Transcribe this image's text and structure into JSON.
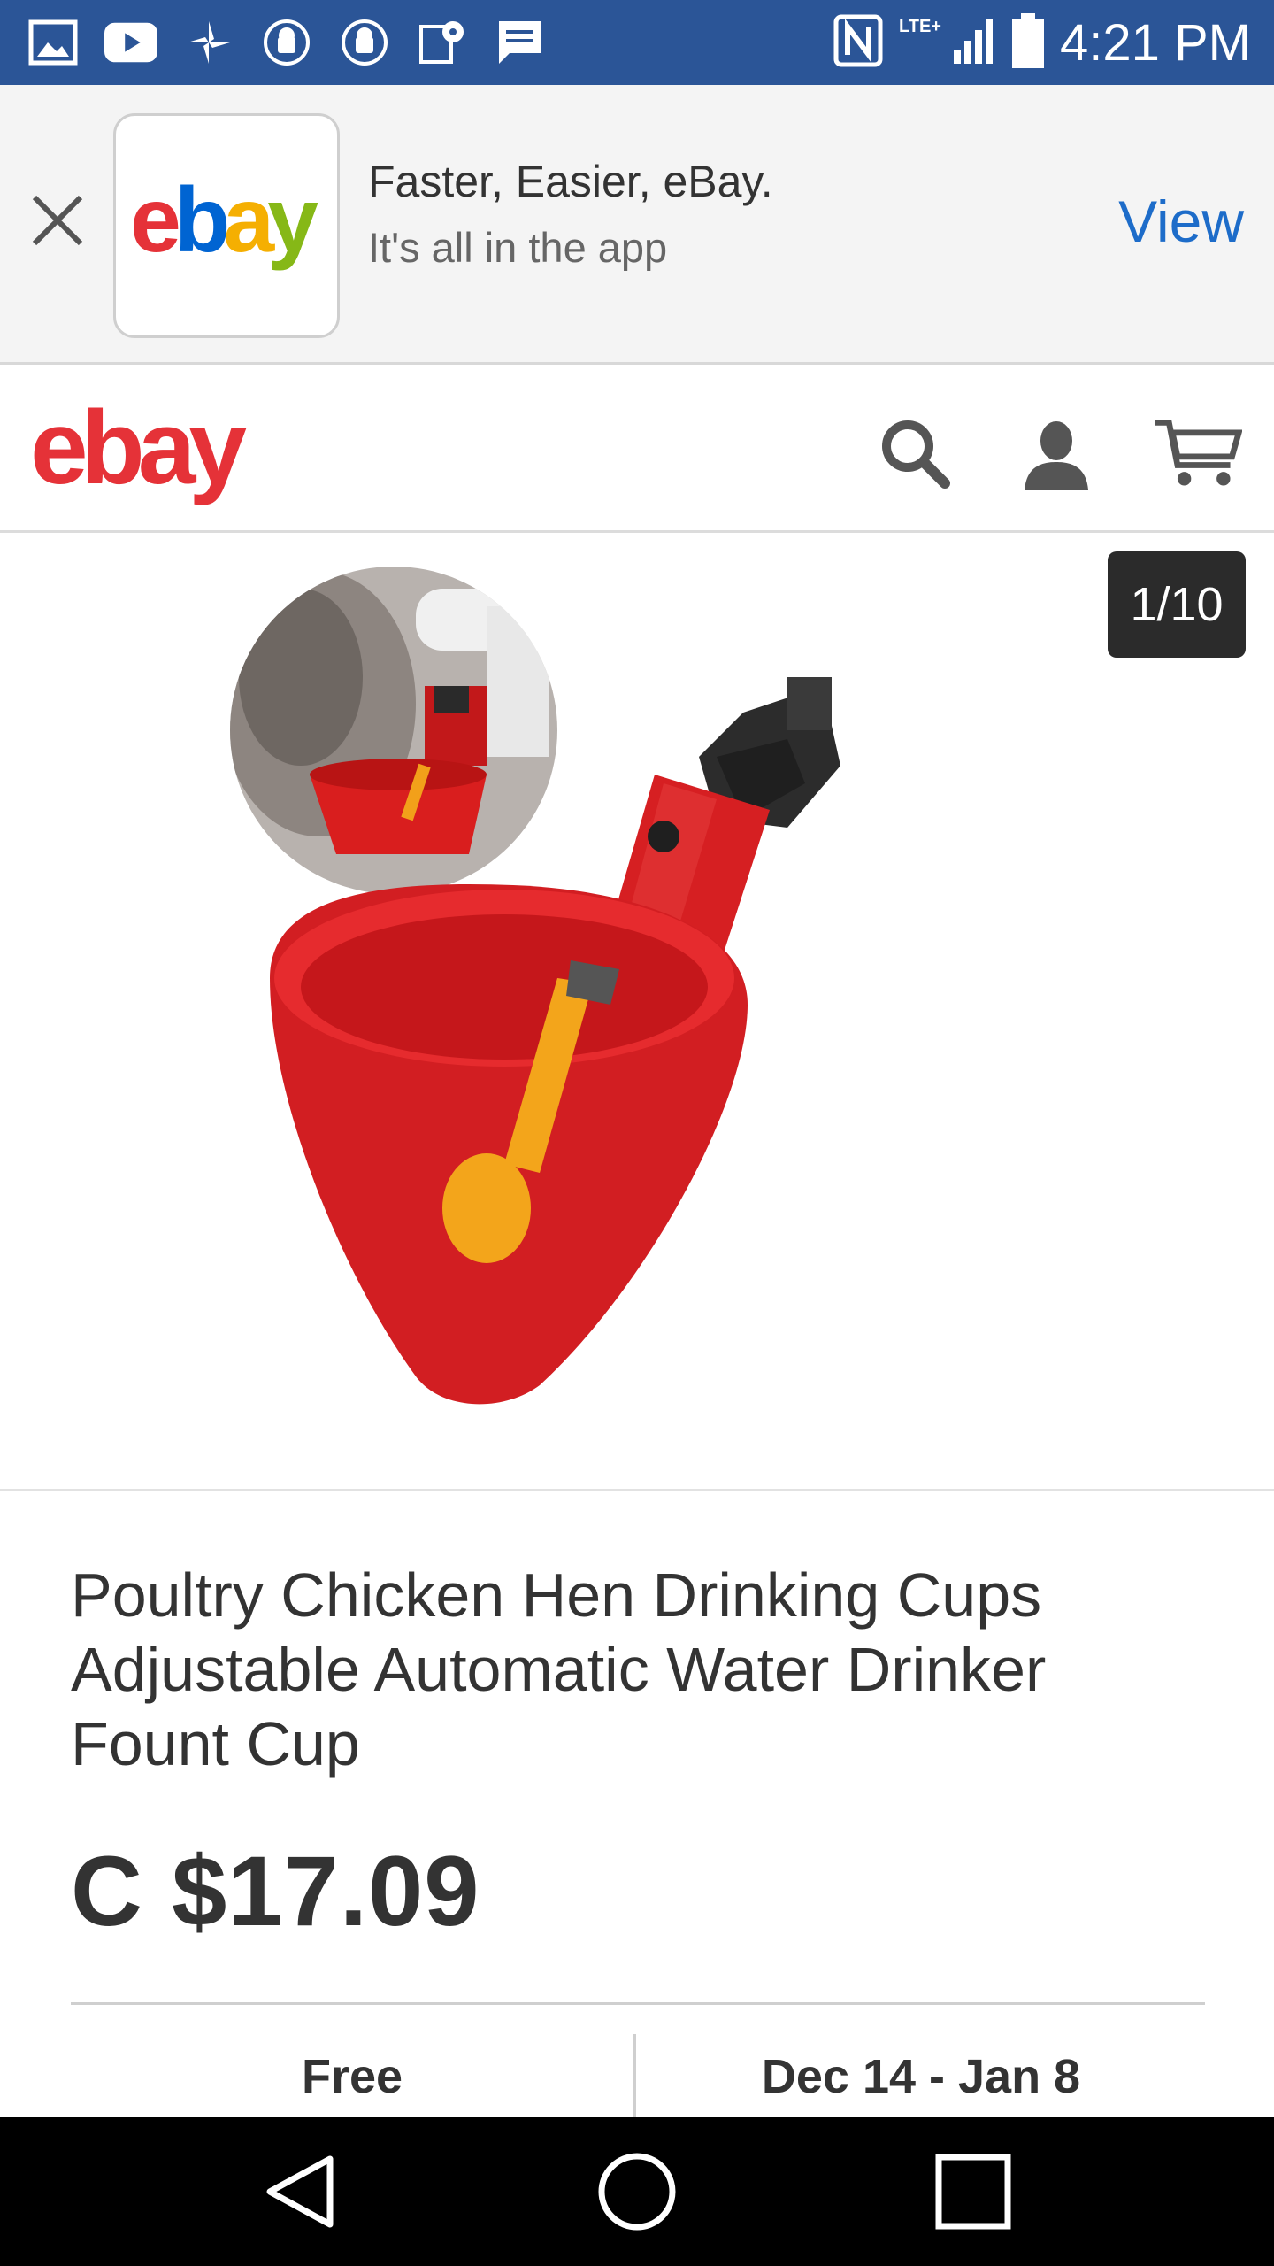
{
  "status_bar": {
    "time": "4:21 PM",
    "left_icons": [
      "gallery-icon",
      "youtube-icon",
      "pinwheel-icon",
      "android-icon",
      "android-icon",
      "maps-icon",
      "message-icon"
    ],
    "right_icons": [
      "nfc-icon",
      "lte-signal-icon",
      "battery-icon"
    ],
    "background": "#2b5597"
  },
  "app_banner": {
    "title": "Faster, Easier, eBay.",
    "subtitle": "It's all in the app",
    "action_label": "View",
    "logo_text": "ebay",
    "close_icon": "close-icon"
  },
  "header": {
    "logo_text": "ebay",
    "icons": [
      "search-icon",
      "user-icon",
      "cart-icon"
    ]
  },
  "gallery": {
    "counter": "1/10",
    "image_alt": "Red poultry drinking cup with yellow nipple and black fitting"
  },
  "product": {
    "title": "Poultry Chicken Hen Drinking Cups Adjustable Automatic Water Drinker Fount Cup",
    "price": "C $17.09"
  },
  "shipping": {
    "cost": "Free",
    "delivery": "Dec 14 - Jan 8"
  },
  "nav_bar": {
    "buttons": [
      "back-icon",
      "home-icon",
      "recents-icon"
    ]
  },
  "colors": {
    "ebay_red": "#e53238",
    "ebay_blue": "#0064d2",
    "ebay_yellow": "#f5af02",
    "ebay_green": "#86b817",
    "link_blue": "#1d6cc9"
  }
}
